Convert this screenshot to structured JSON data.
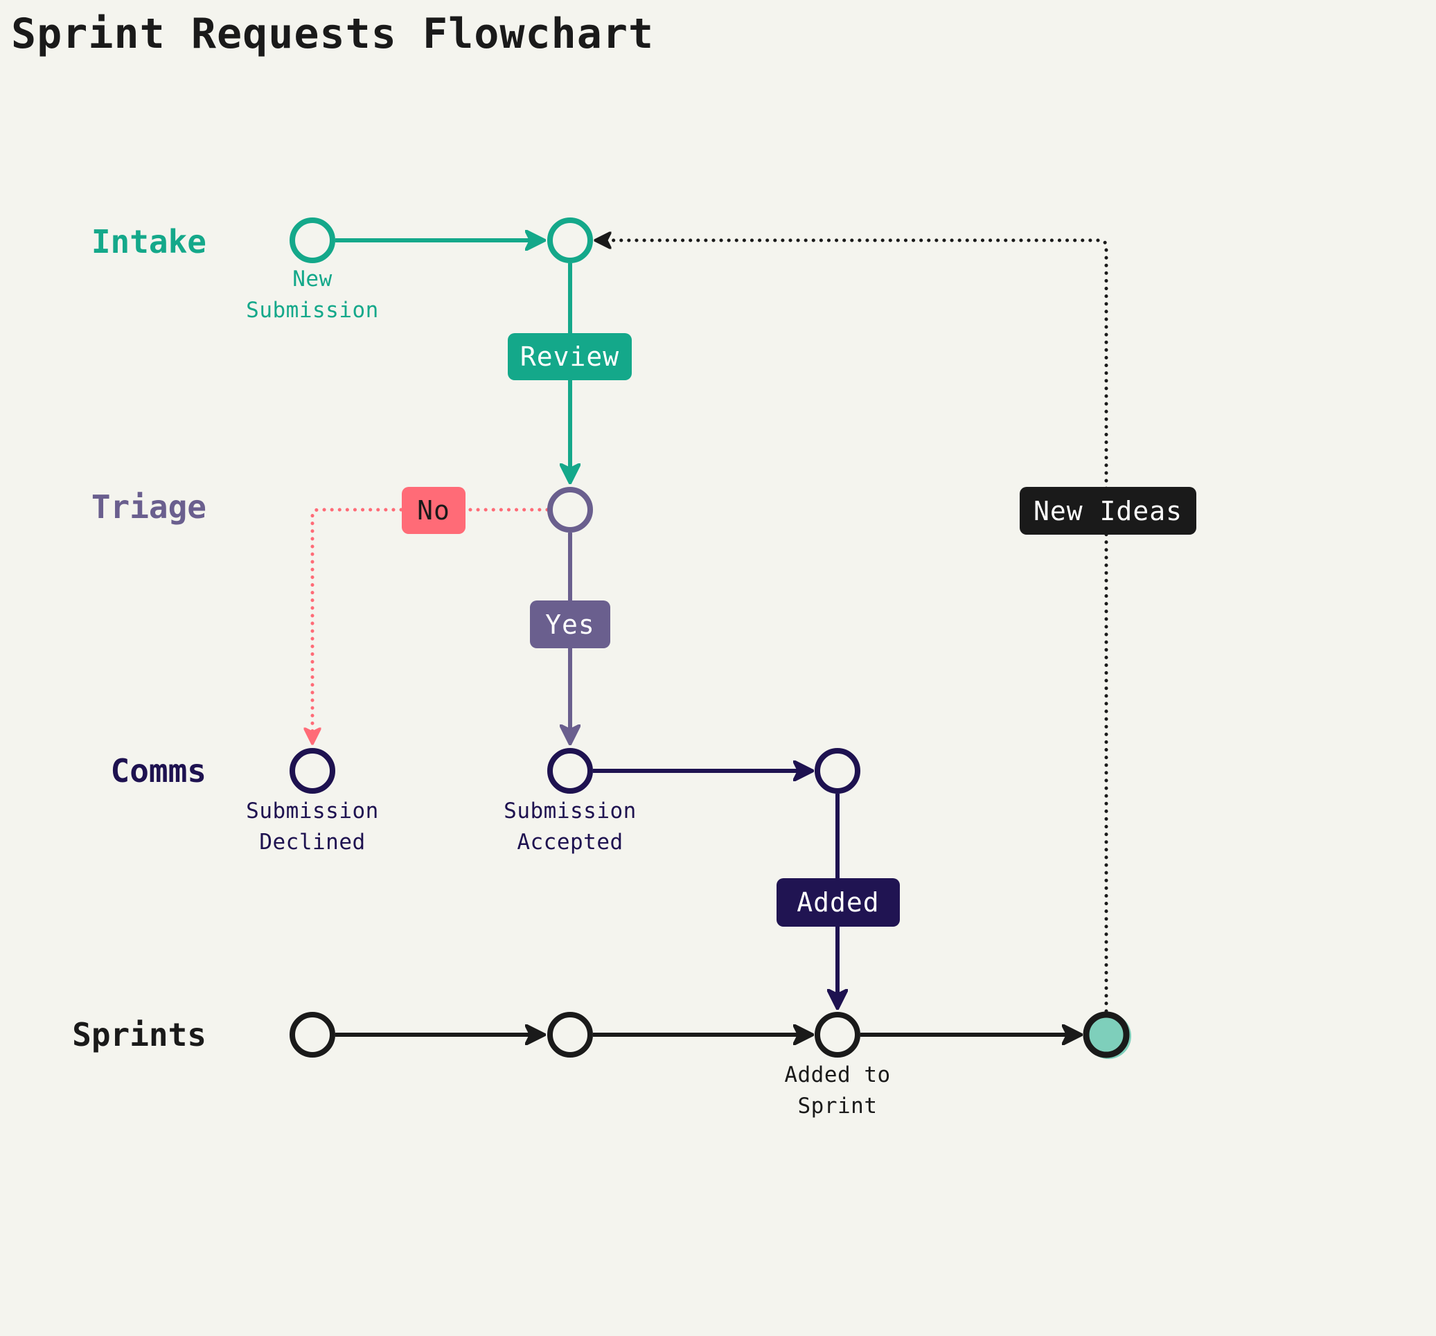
{
  "title": "Sprint Requests Flowchart",
  "colors": {
    "background": "#f4f4ee",
    "intake": "#14a88a",
    "triage": "#6a5f8e",
    "comms": "#1e1250",
    "sprints": "#1a1a1a",
    "declined": "#ff6b77",
    "final_fill": "#7ecfbb"
  },
  "lanes": [
    {
      "id": "intake",
      "label": "Intake"
    },
    {
      "id": "triage",
      "label": "Triage"
    },
    {
      "id": "comms",
      "label": "Comms"
    },
    {
      "id": "sprints",
      "label": "Sprints"
    }
  ],
  "nodes": [
    {
      "id": "new-submission",
      "lane": "intake",
      "caption": "New\nSubmission"
    },
    {
      "id": "intake-review",
      "lane": "intake",
      "caption": ""
    },
    {
      "id": "triage-decision",
      "lane": "triage",
      "caption": ""
    },
    {
      "id": "submission-declined",
      "lane": "comms",
      "caption": "Submission\nDeclined"
    },
    {
      "id": "submission-accepted",
      "lane": "comms",
      "caption": "Submission\nAccepted"
    },
    {
      "id": "comms-added",
      "lane": "comms",
      "caption": ""
    },
    {
      "id": "sprint-1",
      "lane": "sprints",
      "caption": ""
    },
    {
      "id": "sprint-2",
      "lane": "sprints",
      "caption": ""
    },
    {
      "id": "added-to-sprint",
      "lane": "sprints",
      "caption": "Added to\nSprint"
    },
    {
      "id": "sprint-final",
      "lane": "sprints",
      "caption": ""
    }
  ],
  "edges": [
    {
      "from": "new-submission",
      "to": "intake-review",
      "style": "solid"
    },
    {
      "from": "intake-review",
      "to": "triage-decision",
      "style": "solid",
      "label": "Review"
    },
    {
      "from": "triage-decision",
      "to": "submission-declined",
      "style": "dotted",
      "label": "No"
    },
    {
      "from": "triage-decision",
      "to": "submission-accepted",
      "style": "solid",
      "label": "Yes"
    },
    {
      "from": "submission-accepted",
      "to": "comms-added",
      "style": "solid"
    },
    {
      "from": "comms-added",
      "to": "added-to-sprint",
      "style": "solid",
      "label": "Added"
    },
    {
      "from": "sprint-1",
      "to": "sprint-2",
      "style": "solid"
    },
    {
      "from": "sprint-2",
      "to": "added-to-sprint",
      "style": "solid"
    },
    {
      "from": "added-to-sprint",
      "to": "sprint-final",
      "style": "solid"
    },
    {
      "from": "sprint-final",
      "to": "intake-review",
      "style": "dotted",
      "label": "New Ideas"
    }
  ],
  "badges": {
    "review": "Review",
    "no": "No",
    "yes": "Yes",
    "added": "Added",
    "new_ideas": "New Ideas"
  }
}
